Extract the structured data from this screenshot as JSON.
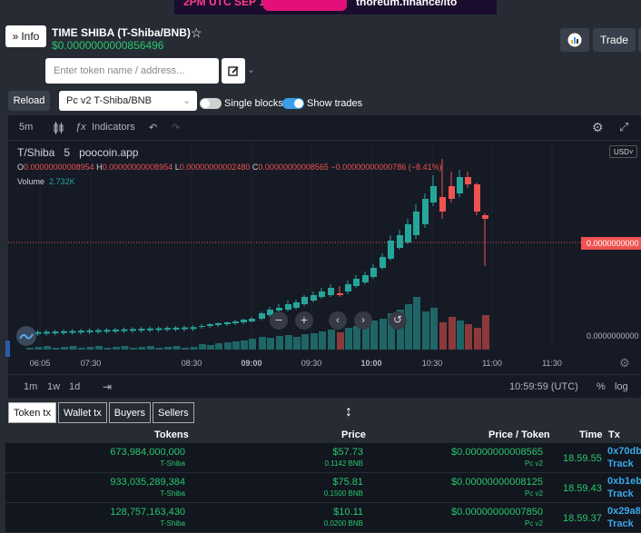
{
  "banner": {
    "left_text": "2PM UTC SEP 12",
    "right_text": "thoreum.finance/ito"
  },
  "header": {
    "info_label": "Info",
    "token_title": "TIME SHIBA (T-Shiba/BNB)",
    "token_price": "$0.0000000000856496",
    "trade_label": "Trade"
  },
  "search": {
    "placeholder": "Enter token name / address..."
  },
  "controls": {
    "reload_label": "Reload",
    "pair_value": "Pc v2 T-Shiba/BNB",
    "single_blocks_label": "Single blocks",
    "single_blocks_on": false,
    "show_trades_label": "Show trades",
    "show_trades_on": true
  },
  "chart_toolbar": {
    "interval": "5m",
    "indicators_label": "Indicators"
  },
  "chart_header": {
    "symbol": "T/Shiba",
    "interval": "5",
    "source": "poocoin.app",
    "currency": "USD",
    "o_label": "O",
    "o_value": "0.00000000008954",
    "h_label": "H",
    "h_value": "0.00000000008954",
    "l_label": "L",
    "l_value": "0.00000000002480",
    "c_label": "C",
    "c_value": "0.00000000008565",
    "change": "−0.00000000000786 (−8.41%)",
    "volume_label": "Volume",
    "volume_value": "2.732K",
    "price_line_label": "0.0000000000",
    "axis_low_label": "0.0000000000"
  },
  "chart_data": {
    "type": "candlestick",
    "x_ticks": [
      "06:05",
      "07:30",
      "08:30",
      "09:00",
      "09:30",
      "10:00",
      "10:30",
      "11:00",
      "11:30"
    ],
    "x_bold_ticks": [
      "09:00",
      "10:00"
    ],
    "last_close": "0.00000000008565",
    "colors": {
      "up": "#26a69a",
      "down": "#ef5350"
    }
  },
  "chart_bottom": {
    "ranges": [
      "1m",
      "1w",
      "1d"
    ],
    "time": "10:59:59 (UTC)",
    "pct": "%",
    "log": "log"
  },
  "tabs": [
    "Token tx",
    "Wallet tx",
    "Buyers",
    "Sellers"
  ],
  "tx_table": {
    "headers": {
      "tokens": "Tokens",
      "price": "Price",
      "price_token": "Price / Token",
      "time": "Time",
      "tx": "Tx"
    },
    "rows": [
      {
        "tokens": "673,984,000,000",
        "token_sym": "T-Shiba",
        "price": "$57.73",
        "bnb": "0.1142 BNB",
        "pt": "$0.00000000008565",
        "pt_sub": "Pc v2",
        "time": "18.59.55",
        "tx": "0x70db",
        "track": "Track"
      },
      {
        "tokens": "933,035,289,384",
        "token_sym": "T-Shiba",
        "price": "$75.81",
        "bnb": "0.1500 BNB",
        "pt": "$0.00000000008125",
        "pt_sub": "Pc v2",
        "time": "18.59.43",
        "tx": "0xb1eb",
        "track": "Track"
      },
      {
        "tokens": "128,757,163,430",
        "token_sym": "T-Shiba",
        "price": "$10.11",
        "bnb": "0.0200 BNB",
        "pt": "$0.00000000007850",
        "pt_sub": "Pc v2",
        "time": "18.59.37",
        "tx": "0x29a8",
        "track": "Track"
      }
    ]
  }
}
